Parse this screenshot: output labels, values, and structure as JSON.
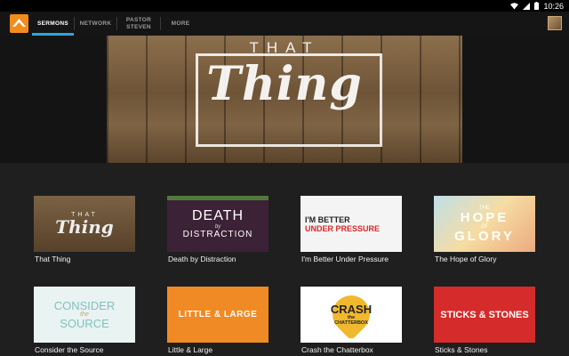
{
  "status_bar": {
    "time": "10:26"
  },
  "tabs": [
    {
      "label": "SERMONS",
      "active": true
    },
    {
      "label": "NETWORK",
      "active": false
    },
    {
      "label": "PASTOR STEVEN",
      "active": false
    },
    {
      "label": "MORE",
      "active": false
    }
  ],
  "hero": {
    "line1": "THAT",
    "line2": "Thing"
  },
  "sermons": [
    {
      "title": "That Thing",
      "art": [
        "THAT",
        "Thing"
      ]
    },
    {
      "title": "Death by Distraction",
      "art": [
        "DEATH",
        "by",
        "DISTRACTION"
      ]
    },
    {
      "title": "I'm Better Under Pressure",
      "art": [
        "I'M BETTER",
        "UNDER PRESSURE"
      ]
    },
    {
      "title": "The Hope of Glory",
      "art": [
        "THE",
        "HOPE",
        "OF",
        "GLORY"
      ]
    },
    {
      "title": "Consider the Source",
      "art": [
        "CONSIDER",
        "the",
        "SOURCE"
      ]
    },
    {
      "title": "Little & Large",
      "art": [
        "LITTLE & LARGE"
      ]
    },
    {
      "title": "Crash the Chatterbox",
      "art": [
        "CRASH",
        "the",
        "CHATTERBOX"
      ]
    },
    {
      "title": "Sticks & Stones",
      "art": [
        "STICKS & STONES"
      ]
    }
  ],
  "colors": {
    "accent": "#29a8e0",
    "brand": "#f28c1c"
  }
}
